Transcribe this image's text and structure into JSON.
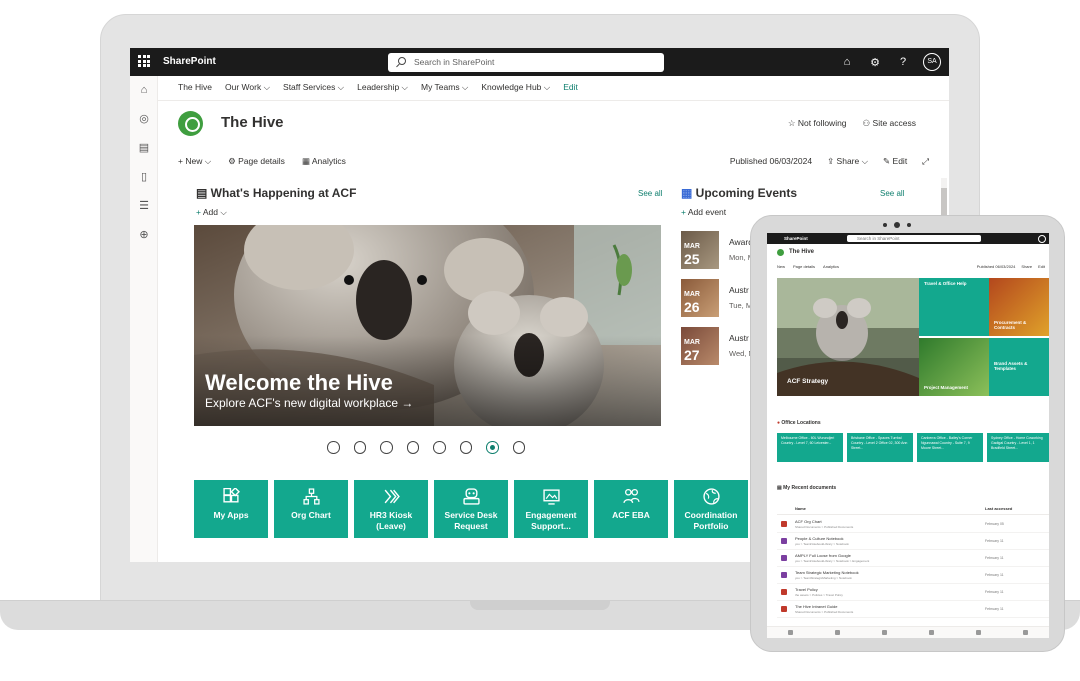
{
  "suite": {
    "app_name": "SharePoint",
    "search_placeholder": "Search in SharePoint",
    "avatar_initials": "SA"
  },
  "nav": {
    "items": [
      {
        "label": "The Hive"
      },
      {
        "label": "Our Work ⌵"
      },
      {
        "label": "Staff Services ⌵"
      },
      {
        "label": "Leadership ⌵"
      },
      {
        "label": "My Teams ⌵"
      },
      {
        "label": "Knowledge Hub ⌵"
      },
      {
        "label": "Edit"
      }
    ]
  },
  "site": {
    "title": "The Hive",
    "not_following": "Not following",
    "site_access": "Site access"
  },
  "command_bar": {
    "new": "New",
    "page_details": "Page details",
    "analytics": "Analytics",
    "published": "Published 06/03/2024",
    "share": "Share",
    "edit": "Edit"
  },
  "news": {
    "title": "What's Happening at ACF",
    "see_all": "See all",
    "add": "Add"
  },
  "hero": {
    "title": "Welcome the Hive",
    "subtitle": "Explore ACF's new digital workplace →",
    "slide_count": 8,
    "active_slide": 7
  },
  "quick_links": [
    {
      "label": "My Apps",
      "icon": "apps-icon"
    },
    {
      "label": "Org Chart",
      "icon": "org-chart-icon"
    },
    {
      "label": "HR3 Kiosk (Leave)",
      "icon": "kiosk-icon"
    },
    {
      "label": "Service Desk Request",
      "icon": "service-desk-icon"
    },
    {
      "label": "Engagement Support...",
      "icon": "engagement-icon"
    },
    {
      "label": "ACF EBA",
      "icon": "people-icon"
    },
    {
      "label": "Coordination Portfolio",
      "icon": "globe-icon"
    }
  ],
  "events": {
    "title": "Upcoming Events",
    "see_all": "See all",
    "add": "Add event",
    "items": [
      {
        "month": "MAR",
        "day": "25",
        "title": "Award",
        "time": "Mon, M"
      },
      {
        "month": "MAR",
        "day": "26",
        "title": "Austr",
        "time": "Tue, M"
      },
      {
        "month": "MAR",
        "day": "27",
        "title": "Austr",
        "time": "Wed, M"
      }
    ]
  },
  "tablet": {
    "app_name": "SharePoint",
    "search_placeholder": "Search in SharePoint",
    "site_title": "The Hive",
    "cmd": [
      "New",
      "Page details",
      "Analytics"
    ],
    "published": "Published 06/03/2024",
    "share": "Share",
    "edit": "Edit",
    "hero_main": "ACF Strategy",
    "hero_tiles": [
      "Travel & Office Help",
      "Procurement & Contracts",
      "Project Management",
      "Brand Assets & Templates"
    ],
    "office_section": "Office Locations",
    "offices": [
      "Melbourne Office - 60L Wurundjeri Country - Level 7, 60 Leicester...",
      "Brisbane Office - Spaces Turrbal Country - Level 2 Office 02, 300 Ann Street...",
      "Canberra Office - Bailey's Corner Ngunnawal Country - Suite 7, 9 Moore Street...",
      "Sydney Office - Home Coworking Gadigal Country - Level 1, 1 Bradfield Street..."
    ],
    "docs_section": "My Recent documents",
    "docs_col_name": "Name",
    "docs_col_date": "Last accessed",
    "docs": [
      {
        "name": "ACF Org Chart",
        "path": "Shared Documents > Published Documents",
        "date": "February 05"
      },
      {
        "name": "People & Culture Notebook",
        "path": "you > TeamNotebookLibrary > Notebook",
        "date": "February 11"
      },
      {
        "name": "AMPLY Full Loose from Google",
        "path": "you > TeamNotebookLibrary > Notebook > Engagement",
        "date": "February 11"
      },
      {
        "name": "Team Strategic Marketing Notebook",
        "path": "you > TeamStrategicMarketing > Notebook",
        "date": "February 11"
      },
      {
        "name": "Travel Policy",
        "path": "the assets > Policies > Travel Policy",
        "date": "February 11"
      },
      {
        "name": "The Hive Intranet Guide",
        "path": "Shared Documents > Published Documents",
        "date": "February 11"
      }
    ]
  },
  "colors": {
    "accent": "#13a88e",
    "link": "#0f7f6e",
    "suitebar": "#1b1b1b"
  }
}
